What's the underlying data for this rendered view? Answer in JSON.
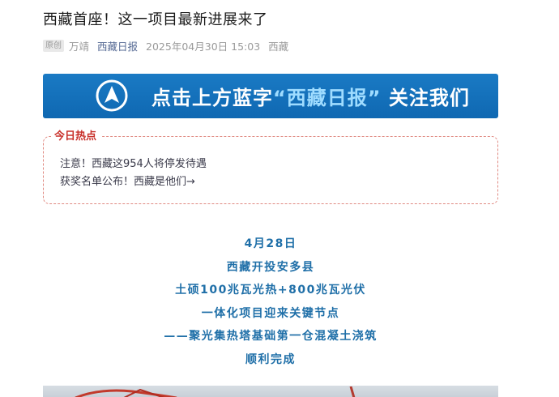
{
  "article": {
    "title": "西藏首座！这一项目最新进展来了",
    "meta": {
      "original_tag": "原创",
      "author": "万靖",
      "account": "西藏日报",
      "datetime": "2025年04月30日 15:03",
      "location": "西藏"
    }
  },
  "banner": {
    "text_prefix": "点击上方蓝字",
    "text_highlight": "“西藏日报”",
    "text_suffix": "关注我们",
    "colors": {
      "background": "#1270b7",
      "highlight": "#9fdcff"
    }
  },
  "hot_topics": {
    "title": "今日热点",
    "items": [
      {
        "label": "注意！西藏这954人将停发待遇"
      },
      {
        "label": "获奖名单公布！西藏是他们→"
      }
    ]
  },
  "body": {
    "lines": [
      "4月28日",
      "西藏开投安多县",
      "土硕100兆瓦光热+800兆瓦光伏",
      "一体化项目迎来关键节点",
      "——聚光集热塔基础第一仓混凝土浇筑",
      "顺利完成"
    ],
    "color": "#1f6fa8"
  }
}
